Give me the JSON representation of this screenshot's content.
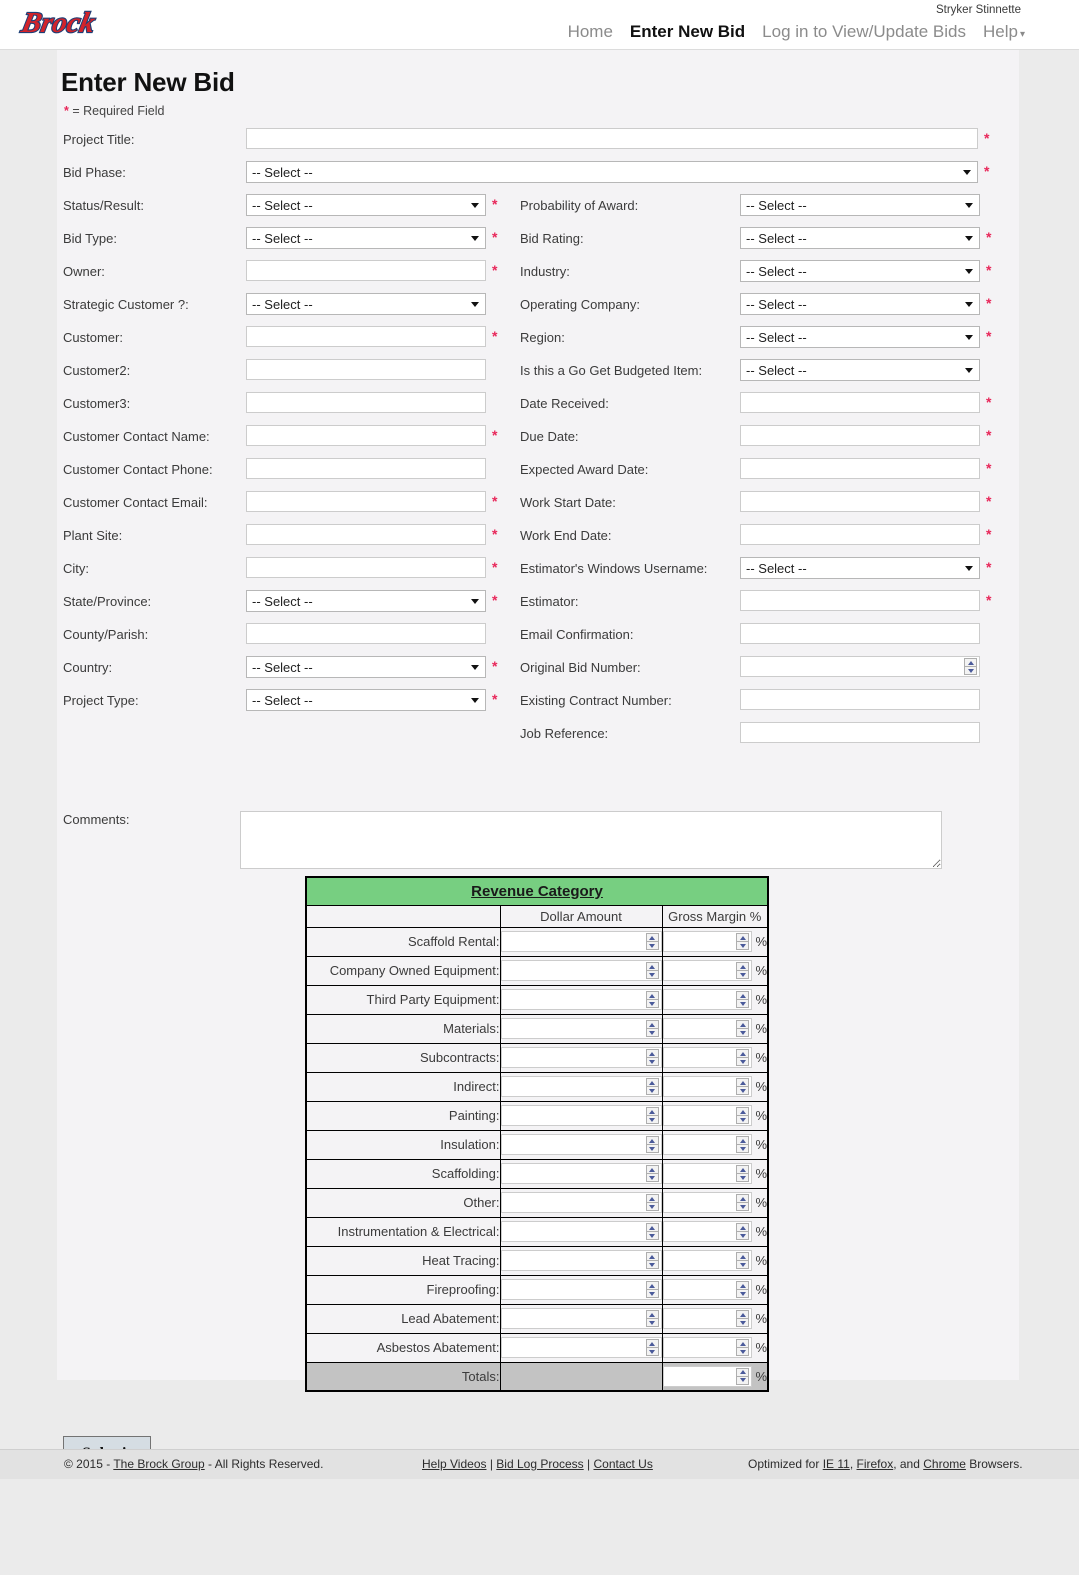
{
  "header": {
    "logo_text": "Brock",
    "user_name": "Stryker Stinnette",
    "nav": [
      {
        "label": "Home",
        "active": false
      },
      {
        "label": "Enter New Bid",
        "active": true
      },
      {
        "label": "Log in to View/Update Bids",
        "active": false
      },
      {
        "label": "Help",
        "active": false,
        "caret": "▾"
      }
    ]
  },
  "page": {
    "title": "Enter New Bid",
    "required_note_star": "*",
    "required_note": "= Required Field",
    "select_placeholder": "-- Select --"
  },
  "form": {
    "full_width_fields": [
      {
        "label": "Project Title:",
        "type": "text",
        "value": "",
        "required": true
      },
      {
        "label": "Bid Phase:",
        "type": "select",
        "value": "-- Select --",
        "required": true
      }
    ],
    "left_column": [
      {
        "label": "Status/Result:",
        "type": "select",
        "value": "-- Select --",
        "required": true
      },
      {
        "label": "Bid Type:",
        "type": "select",
        "value": "-- Select --",
        "required": true
      },
      {
        "label": "Owner:",
        "type": "text",
        "value": "",
        "required": true
      },
      {
        "label": "Strategic Customer ?:",
        "type": "select",
        "value": "-- Select --",
        "required": false
      },
      {
        "label": "Customer:",
        "type": "text",
        "value": "",
        "required": true
      },
      {
        "label": "Customer2:",
        "type": "text",
        "value": "",
        "required": false
      },
      {
        "label": "Customer3:",
        "type": "text",
        "value": "",
        "required": false
      },
      {
        "label": "Customer Contact Name:",
        "type": "text",
        "value": "",
        "required": true
      },
      {
        "label": "Customer Contact Phone:",
        "type": "text",
        "value": "",
        "required": false
      },
      {
        "label": "Customer Contact Email:",
        "type": "text",
        "value": "",
        "required": true
      },
      {
        "label": "Plant Site:",
        "type": "text",
        "value": "",
        "required": true
      },
      {
        "label": "City:",
        "type": "text",
        "value": "",
        "required": true
      },
      {
        "label": "State/Province:",
        "type": "select",
        "value": "-- Select --",
        "required": true
      },
      {
        "label": "County/Parish:",
        "type": "text",
        "value": "",
        "required": false
      },
      {
        "label": "Country:",
        "type": "select",
        "value": "-- Select --",
        "required": true
      },
      {
        "label": "Project Type:",
        "type": "select",
        "value": "-- Select --",
        "required": true
      }
    ],
    "right_column": [
      {
        "label": "Probability of Award:",
        "type": "select",
        "value": "-- Select --",
        "required": false
      },
      {
        "label": "Bid Rating:",
        "type": "select",
        "value": "-- Select --",
        "required": true
      },
      {
        "label": "Industry:",
        "type": "select",
        "value": "-- Select --",
        "required": true
      },
      {
        "label": "Operating Company:",
        "type": "select",
        "value": "-- Select --",
        "required": true
      },
      {
        "label": "Region:",
        "type": "select",
        "value": "-- Select --",
        "required": true
      },
      {
        "label": "Is this a Go Get Budgeted Item:",
        "type": "select",
        "value": "-- Select --",
        "required": false
      },
      {
        "label": "Date Received:",
        "type": "text",
        "value": "",
        "required": true
      },
      {
        "label": "Due Date:",
        "type": "text",
        "value": "",
        "required": true
      },
      {
        "label": "Expected Award Date:",
        "type": "text",
        "value": "",
        "required": true
      },
      {
        "label": "Work Start Date:",
        "type": "text",
        "value": "",
        "required": true
      },
      {
        "label": "Work End Date:",
        "type": "text",
        "value": "",
        "required": true
      },
      {
        "label": "Estimator's Windows Username:",
        "type": "select",
        "value": "-- Select --",
        "required": true
      },
      {
        "label": "Estimator:",
        "type": "text",
        "value": "",
        "required": true
      },
      {
        "label": "Email Confirmation:",
        "type": "text",
        "value": "",
        "required": false
      },
      {
        "label": "Original Bid Number:",
        "type": "number",
        "value": "",
        "required": false
      },
      {
        "label": "Existing Contract Number:",
        "type": "text",
        "value": "",
        "required": false
      },
      {
        "label": "Job Reference:",
        "type": "text",
        "value": "",
        "required": false
      }
    ],
    "comments": {
      "label": "Comments:",
      "value": "",
      "placeholder": ""
    }
  },
  "revenue_table": {
    "title": "Revenue Category",
    "title_color": "#77cf81",
    "columns": [
      "",
      "Dollar Amount",
      "Gross Margin %"
    ],
    "percent_suffix": "%",
    "rows": [
      {
        "label": "Scaffold Rental:",
        "amount": "",
        "margin": ""
      },
      {
        "label": "Company Owned Equipment:",
        "amount": "",
        "margin": ""
      },
      {
        "label": "Third Party Equipment:",
        "amount": "",
        "margin": ""
      },
      {
        "label": "Materials:",
        "amount": "",
        "margin": ""
      },
      {
        "label": "Subcontracts:",
        "amount": "",
        "margin": ""
      },
      {
        "label": "Indirect:",
        "amount": "",
        "margin": ""
      },
      {
        "label": "Painting:",
        "amount": "",
        "margin": ""
      },
      {
        "label": "Insulation:",
        "amount": "",
        "margin": ""
      },
      {
        "label": "Scaffolding:",
        "amount": "",
        "margin": ""
      },
      {
        "label": "Other:",
        "amount": "",
        "margin": ""
      },
      {
        "label": "Instrumentation & Electrical:",
        "amount": "",
        "margin": ""
      },
      {
        "label": "Heat Tracing:",
        "amount": "",
        "margin": ""
      },
      {
        "label": "Fireproofing:",
        "amount": "",
        "margin": ""
      },
      {
        "label": "Lead Abatement:",
        "amount": "",
        "margin": ""
      },
      {
        "label": "Asbestos Abatement:",
        "amount": "",
        "margin": ""
      }
    ],
    "totals_row": {
      "label": "Totals:",
      "amount": "",
      "margin": ""
    }
  },
  "actions": {
    "submit_label": "Submit"
  },
  "footer": {
    "copyright_prefix": "© 2015 - ",
    "company_link": "The Brock Group",
    "copyright_suffix": " - All Rights Reserved.",
    "links": [
      "Help Videos",
      "Bid Log Process",
      "Contact Us"
    ],
    "separator": " | ",
    "optimized_prefix": "Optimized for ",
    "browsers": [
      "IE 11",
      "Firefox",
      "Chrome"
    ],
    "optimized_suffix": " Browsers.",
    "browser_join_1": ", ",
    "browser_join_2": ", and "
  }
}
